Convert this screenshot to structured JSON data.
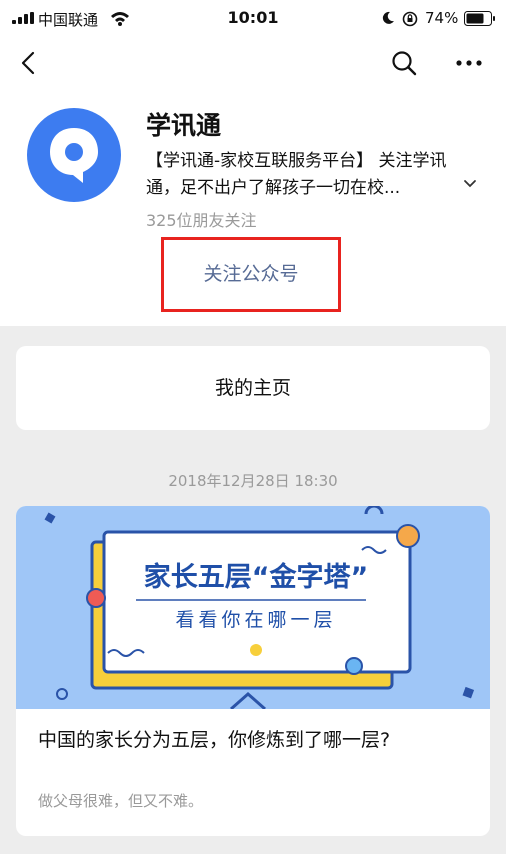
{
  "status_bar": {
    "carrier": "中国联通",
    "time": "10:01",
    "battery_percent": "74%",
    "battery_level": 0.74
  },
  "nav": {
    "back_icon": "chevron-left-icon",
    "search_icon": "search-icon",
    "more_icon": "more-icon"
  },
  "account": {
    "name": "学讯通",
    "description": "【学讯通-家校互联服务平台】 关注学讯通，足不出户了解孩子一切在校...",
    "followers": "325位朋友关注",
    "follow_button": "关注公众号",
    "brand_color": "#3d7cf0",
    "highlight_color": "#e8231f"
  },
  "home_link": "我的主页",
  "feed": {
    "date": "2018年12月28日 18:30",
    "article": {
      "cover_title": "家长五层“金字塔”",
      "cover_subtitle": "看看你在哪一层",
      "title": "中国的家长分为五层，你修炼到了哪一层?",
      "summary": "做父母很难，但又不难。"
    }
  }
}
